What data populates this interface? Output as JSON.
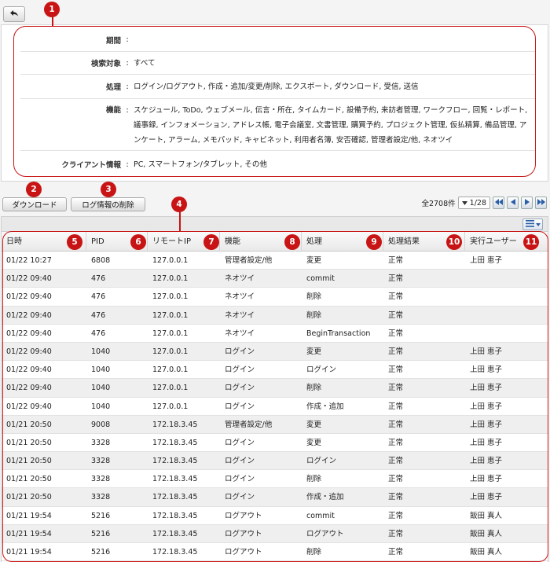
{
  "info": {
    "rows": [
      {
        "label": "期間",
        "colon": ":",
        "value": ""
      },
      {
        "label": "検索対象",
        "colon": ":",
        "value": "すべて"
      },
      {
        "label": "処理",
        "colon": ":",
        "value": "ログイン/ログアウト, 作成・追加/変更/削除, エクスポート, ダウンロード, 受信, 送信"
      },
      {
        "label": "機能",
        "colon": ":",
        "value": "スケジュール, ToDo, ウェブメール, 伝言・所在, タイムカード, 設備予約, 来訪者管理, ワークフロー, 回覧・レポート, 議事録, インフォメーション, アドレス帳, 電子会議室, 文書管理, 購買予約, プロジェクト管理, 仮払精算, 備品管理, アンケート, アラーム, メモパッド, キャビネット, 利用者名簿, 安否確認, 管理者設定/他, ネオツイ"
      },
      {
        "label": "クライアント情報",
        "colon": ":",
        "value": "PC, スマートフォン/タブレット, その他"
      }
    ]
  },
  "actions": {
    "download_label": "ダウンロード",
    "delete_log_label": "ログ情報の削除"
  },
  "pager": {
    "total_text": "全2708件",
    "page_value": "1/28"
  },
  "grid": {
    "headers": [
      "日時",
      "PID",
      "リモートIP",
      "機能",
      "処理",
      "処理結果",
      "実行ユーザー"
    ],
    "rows": [
      [
        "01/22 10:27",
        "6808",
        "127.0.0.1",
        "管理者設定/他",
        "変更",
        "正常",
        "上田 恵子"
      ],
      [
        "01/22 09:40",
        "476",
        "127.0.0.1",
        "ネオツイ",
        "commit",
        "正常",
        ""
      ],
      [
        "01/22 09:40",
        "476",
        "127.0.0.1",
        "ネオツイ",
        "削除",
        "正常",
        ""
      ],
      [
        "01/22 09:40",
        "476",
        "127.0.0.1",
        "ネオツイ",
        "削除",
        "正常",
        ""
      ],
      [
        "01/22 09:40",
        "476",
        "127.0.0.1",
        "ネオツイ",
        "BeginTransaction",
        "正常",
        ""
      ],
      [
        "01/22 09:40",
        "1040",
        "127.0.0.1",
        "ログイン",
        "変更",
        "正常",
        "上田 恵子"
      ],
      [
        "01/22 09:40",
        "1040",
        "127.0.0.1",
        "ログイン",
        "ログイン",
        "正常",
        "上田 恵子"
      ],
      [
        "01/22 09:40",
        "1040",
        "127.0.0.1",
        "ログイン",
        "削除",
        "正常",
        "上田 恵子"
      ],
      [
        "01/22 09:40",
        "1040",
        "127.0.0.1",
        "ログイン",
        "作成・追加",
        "正常",
        "上田 恵子"
      ],
      [
        "01/21 20:50",
        "9008",
        "172.18.3.45",
        "管理者設定/他",
        "変更",
        "正常",
        "上田 恵子"
      ],
      [
        "01/21 20:50",
        "3328",
        "172.18.3.45",
        "ログイン",
        "変更",
        "正常",
        "上田 恵子"
      ],
      [
        "01/21 20:50",
        "3328",
        "172.18.3.45",
        "ログイン",
        "ログイン",
        "正常",
        "上田 恵子"
      ],
      [
        "01/21 20:50",
        "3328",
        "172.18.3.45",
        "ログイン",
        "削除",
        "正常",
        "上田 恵子"
      ],
      [
        "01/21 20:50",
        "3328",
        "172.18.3.45",
        "ログイン",
        "作成・追加",
        "正常",
        "上田 恵子"
      ],
      [
        "01/21 19:54",
        "5216",
        "172.18.3.45",
        "ログアウト",
        "commit",
        "正常",
        "飯田 真人"
      ],
      [
        "01/21 19:54",
        "5216",
        "172.18.3.45",
        "ログアウト",
        "ログアウト",
        "正常",
        "飯田 真人"
      ],
      [
        "01/21 19:54",
        "5216",
        "172.18.3.45",
        "ログアウト",
        "削除",
        "正常",
        "飯田 真人"
      ]
    ]
  },
  "callouts": [
    "1",
    "2",
    "3",
    "4",
    "5",
    "6",
    "7",
    "8",
    "9",
    "10",
    "11"
  ],
  "colors": {
    "callout": "#c81414",
    "nav_arrow": "#2a5da8"
  },
  "icons": {
    "back": "back-arrow-icon",
    "first": "first-page-icon",
    "prev": "prev-page-icon",
    "next": "next-page-icon",
    "last": "last-page-icon",
    "column_menu": "list-menu-icon"
  }
}
